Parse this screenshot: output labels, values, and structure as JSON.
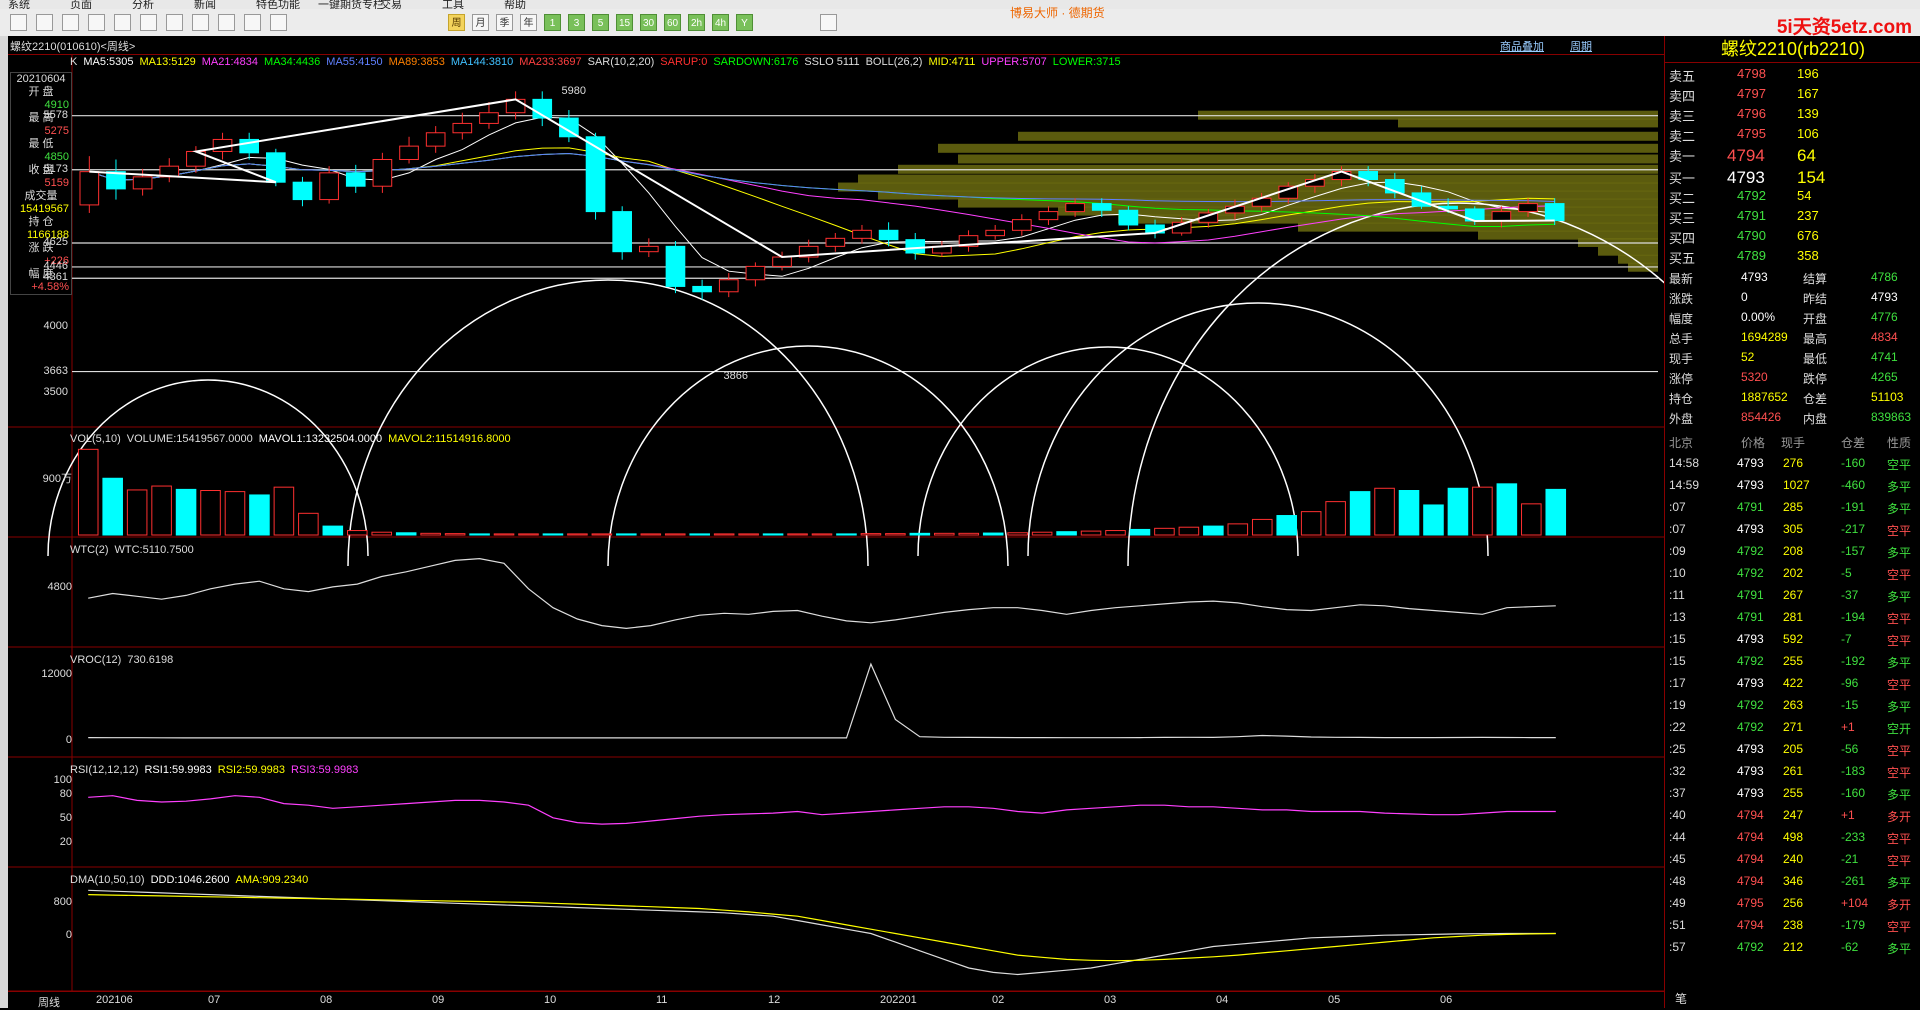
{
  "menu": [
    "系统",
    "页面",
    "分析",
    "新闻",
    "特色功能",
    "一键期货专栏",
    "交易",
    "工具",
    "帮助"
  ],
  "ad_text": "博易大师 · 德期货",
  "brand": "5i天资5etz.com",
  "toolbar_tabs": [
    "周",
    "月",
    "季",
    "年",
    "1",
    "3",
    "5",
    "15",
    "30",
    "60",
    "2h",
    "4h",
    "Y"
  ],
  "active_tab": "周",
  "chart_title": "螺纹2210(010610)<周线>",
  "links": {
    "overlay": "商品叠加",
    "period": "周期"
  },
  "ma_items": [
    {
      "text": "K",
      "color": "#dddddd"
    },
    {
      "text": "MA5:5305",
      "color": "#ffffff"
    },
    {
      "text": "MA13:5129",
      "color": "#ffff00"
    },
    {
      "text": "MA21:4834",
      "color": "#ff40ff"
    },
    {
      "text": "MA34:4436",
      "color": "#00ff00"
    },
    {
      "text": "MA55:4150",
      "color": "#6080ff"
    },
    {
      "text": "MA89:3853",
      "color": "#ff8000"
    },
    {
      "text": "MA144:3810",
      "color": "#40c0ff"
    },
    {
      "text": "MA233:3697",
      "color": "#ff4040"
    },
    {
      "text": "SAR(10,2,20)",
      "color": "#dddddd"
    },
    {
      "text": "SARUP:0",
      "color": "#ff3030"
    },
    {
      "text": "SARDOWN:6176",
      "color": "#00ff00"
    },
    {
      "text": "SSLO 5111",
      "color": "#dddddd"
    },
    {
      "text": "BOLL(26,2)",
      "color": "#dddddd"
    },
    {
      "text": "MID:4711",
      "color": "#ffff00"
    },
    {
      "text": "UPPER:5707",
      "color": "#ff40ff"
    },
    {
      "text": "LOWER:3715",
      "color": "#00ff00"
    }
  ],
  "price_axis": {
    "labels": [
      "5578",
      "5173",
      "4625",
      "4446",
      "4361",
      "4000",
      "3663",
      "3500"
    ]
  },
  "price_markers": {
    "high": "5980",
    "low": "3866"
  },
  "info_box": [
    {
      "label": "20210604",
      "value": "",
      "color": "#ffffff"
    },
    {
      "label": "开 盘",
      "value": "4910",
      "color": "#3fe03f"
    },
    {
      "label": "最 高",
      "value": "5275",
      "color": "#ff5050"
    },
    {
      "label": "最 低",
      "value": "4850",
      "color": "#3fe03f"
    },
    {
      "label": "收 盘",
      "value": "5159",
      "color": "#ff5050"
    },
    {
      "label": "成交量",
      "value": "15419567",
      "color": "#ffff00"
    },
    {
      "label": "持 仓",
      "value": "1166188",
      "color": "#ffff00"
    },
    {
      "label": "涨 跌",
      "value": "+226",
      "color": "#ff5050"
    },
    {
      "label": "幅 度",
      "value": "+4.58%",
      "color": "#ff5050"
    }
  ],
  "indicators": {
    "vol": {
      "items": [
        {
          "text": "VOL(5,10)",
          "color": "#dddddd"
        },
        {
          "text": "VOLUME:15419567.0000",
          "color": "#dddddd"
        },
        {
          "text": "MAVOL1:13232504.0000",
          "color": "#ffffff"
        },
        {
          "text": "MAVOL2:11514916.8000",
          "color": "#ffff00"
        }
      ],
      "ylabel": "900万"
    },
    "wtc": {
      "items": [
        {
          "text": "WTC(2)",
          "color": "#dddddd"
        },
        {
          "text": "WTC:5110.7500",
          "color": "#dddddd"
        }
      ],
      "ylabel": "4800"
    },
    "vroc": {
      "items": [
        {
          "text": "VROC(12)",
          "color": "#dddddd"
        },
        {
          "text": "730.6198",
          "color": "#dddddd"
        }
      ],
      "ylabels": [
        "12000",
        "0"
      ]
    },
    "rsi": {
      "items": [
        {
          "text": "RSI(12,12,12)",
          "color": "#dddddd"
        },
        {
          "text": "RSI1:59.9983",
          "color": "#ffffff"
        },
        {
          "text": "RSI2:59.9983",
          "color": "#ffff00"
        },
        {
          "text": "RSI3:59.9983",
          "color": "#ff40ff"
        }
      ],
      "ylabels": [
        "100",
        "80",
        "50",
        "20"
      ]
    },
    "dma": {
      "items": [
        {
          "text": "DMA(10,50,10)",
          "color": "#dddddd"
        },
        {
          "text": "DDD:1046.2600",
          "color": "#ffffff"
        },
        {
          "text": "AMA:909.2340",
          "color": "#ffff00"
        }
      ],
      "ylabels": [
        "800",
        "0"
      ]
    }
  },
  "x_axis": {
    "label": "周线",
    "ticks": [
      "202106",
      "07",
      "08",
      "09",
      "10",
      "11",
      "12",
      "202201",
      "02",
      "03",
      "04",
      "05",
      "06"
    ]
  },
  "quote": {
    "title": "螺纹2210(rb2210)",
    "asks": [
      {
        "label": "卖五",
        "price": "4798",
        "vol": "196"
      },
      {
        "label": "卖四",
        "price": "4797",
        "vol": "167"
      },
      {
        "label": "卖三",
        "price": "4796",
        "vol": "139"
      },
      {
        "label": "卖二",
        "price": "4795",
        "vol": "106"
      },
      {
        "label": "卖一",
        "price": "4794",
        "vol": "64"
      }
    ],
    "bids": [
      {
        "label": "买一",
        "price": "4793",
        "vol": "154"
      },
      {
        "label": "买二",
        "price": "4792",
        "vol": "54"
      },
      {
        "label": "买三",
        "price": "4791",
        "vol": "237"
      },
      {
        "label": "买四",
        "price": "4790",
        "vol": "676"
      },
      {
        "label": "买五",
        "price": "4789",
        "vol": "358"
      }
    ],
    "stats": [
      {
        "l1": "最新",
        "v1": "4793",
        "c1": "#ffffff",
        "l2": "结算",
        "v2": "4786",
        "c2": "#3fe03f"
      },
      {
        "l1": "涨跌",
        "v1": "0",
        "c1": "#ffffff",
        "l2": "昨结",
        "v2": "4793",
        "c2": "#ffffff"
      },
      {
        "l1": "幅度",
        "v1": "0.00%",
        "c1": "#ffffff",
        "l2": "开盘",
        "v2": "4776",
        "c2": "#3fe03f"
      },
      {
        "l1": "总手",
        "v1": "1694289",
        "c1": "#ffff00",
        "l2": "最高",
        "v2": "4834",
        "c2": "#ff5050"
      },
      {
        "l1": "现手",
        "v1": "52",
        "c1": "#ffff00",
        "l2": "最低",
        "v2": "4741",
        "c2": "#3fe03f"
      },
      {
        "l1": "涨停",
        "v1": "5320",
        "c1": "#ff5050",
        "l2": "跌停",
        "v2": "4265",
        "c2": "#3fe03f"
      },
      {
        "l1": "持仓",
        "v1": "1887652",
        "c1": "#ffff00",
        "l2": "仓差",
        "v2": "51103",
        "c2": "#ffff00"
      },
      {
        "l1": "外盘",
        "v1": "854426",
        "c1": "#ff5050",
        "l2": "内盘",
        "v2": "839863",
        "c2": "#3fe03f"
      }
    ],
    "tick_header": [
      "北京",
      "价格",
      "现手",
      "仓差",
      "性质"
    ],
    "ticks": [
      {
        "t": "14:58",
        "p": "4793",
        "pc": "#ffffff",
        "v": "276",
        "d": "-160",
        "dc": "#3fe03f",
        "n": "空平",
        "nc": "#3fe03f"
      },
      {
        "t": "14:59",
        "p": "4793",
        "pc": "#ffffff",
        "v": "1027",
        "d": "-460",
        "dc": "#3fe03f",
        "n": "多平",
        "nc": "#3fe03f"
      },
      {
        "t": ":07",
        "p": "4791",
        "pc": "#3fe03f",
        "v": "285",
        "d": "-191",
        "dc": "#3fe03f",
        "n": "多平",
        "nc": "#3fe03f"
      },
      {
        "t": ":07",
        "p": "4793",
        "pc": "#ffffff",
        "v": "305",
        "d": "-217",
        "dc": "#3fe03f",
        "n": "空平",
        "nc": "#ff5050"
      },
      {
        "t": ":09",
        "p": "4792",
        "pc": "#3fe03f",
        "v": "208",
        "d": "-157",
        "dc": "#3fe03f",
        "n": "多平",
        "nc": "#3fe03f"
      },
      {
        "t": ":10",
        "p": "4792",
        "pc": "#3fe03f",
        "v": "202",
        "d": "-5",
        "dc": "#3fe03f",
        "n": "空平",
        "nc": "#ff5050"
      },
      {
        "t": ":11",
        "p": "4791",
        "pc": "#3fe03f",
        "v": "267",
        "d": "-37",
        "dc": "#3fe03f",
        "n": "多平",
        "nc": "#3fe03f"
      },
      {
        "t": ":13",
        "p": "4791",
        "pc": "#3fe03f",
        "v": "281",
        "d": "-194",
        "dc": "#3fe03f",
        "n": "空平",
        "nc": "#ff5050"
      },
      {
        "t": ":15",
        "p": "4793",
        "pc": "#ffffff",
        "v": "592",
        "d": "-7",
        "dc": "#3fe03f",
        "n": "空平",
        "nc": "#ff5050"
      },
      {
        "t": ":15",
        "p": "4792",
        "pc": "#3fe03f",
        "v": "255",
        "d": "-192",
        "dc": "#3fe03f",
        "n": "多平",
        "nc": "#3fe03f"
      },
      {
        "t": ":17",
        "p": "4793",
        "pc": "#ffffff",
        "v": "422",
        "d": "-96",
        "dc": "#3fe03f",
        "n": "空平",
        "nc": "#ff5050"
      },
      {
        "t": ":19",
        "p": "4792",
        "pc": "#3fe03f",
        "v": "263",
        "d": "-15",
        "dc": "#3fe03f",
        "n": "多平",
        "nc": "#3fe03f"
      },
      {
        "t": ":22",
        "p": "4792",
        "pc": "#3fe03f",
        "v": "271",
        "d": "+1",
        "dc": "#ff5050",
        "n": "空开",
        "nc": "#3fe03f"
      },
      {
        "t": ":25",
        "p": "4793",
        "pc": "#ffffff",
        "v": "205",
        "d": "-56",
        "dc": "#3fe03f",
        "n": "空平",
        "nc": "#ff5050"
      },
      {
        "t": ":32",
        "p": "4793",
        "pc": "#ffffff",
        "v": "261",
        "d": "-183",
        "dc": "#3fe03f",
        "n": "空平",
        "nc": "#ff5050"
      },
      {
        "t": ":37",
        "p": "4793",
        "pc": "#ffffff",
        "v": "255",
        "d": "-160",
        "dc": "#3fe03f",
        "n": "多平",
        "nc": "#3fe03f"
      },
      {
        "t": ":40",
        "p": "4794",
        "pc": "#ff5050",
        "v": "247",
        "d": "+1",
        "dc": "#ff5050",
        "n": "多开",
        "nc": "#ff5050"
      },
      {
        "t": ":44",
        "p": "4794",
        "pc": "#ff5050",
        "v": "498",
        "d": "-233",
        "dc": "#3fe03f",
        "n": "空平",
        "nc": "#ff5050"
      },
      {
        "t": ":45",
        "p": "4794",
        "pc": "#ff5050",
        "v": "240",
        "d": "-21",
        "dc": "#3fe03f",
        "n": "空平",
        "nc": "#ff5050"
      },
      {
        "t": ":48",
        "p": "4794",
        "pc": "#ff5050",
        "v": "346",
        "d": "-261",
        "dc": "#3fe03f",
        "n": "多平",
        "nc": "#3fe03f"
      },
      {
        "t": ":49",
        "p": "4795",
        "pc": "#ff5050",
        "v": "256",
        "d": "+104",
        "dc": "#ff5050",
        "n": "多开",
        "nc": "#ff5050"
      },
      {
        "t": ":51",
        "p": "4794",
        "pc": "#ff5050",
        "v": "238",
        "d": "-179",
        "dc": "#3fe03f",
        "n": "空平",
        "nc": "#ff5050"
      },
      {
        "t": ":57",
        "p": "4792",
        "pc": "#3fe03f",
        "v": "212",
        "d": "-62",
        "dc": "#3fe03f",
        "n": "多平",
        "nc": "#3fe03f"
      }
    ],
    "footer_tab": "笔"
  },
  "chart_data": {
    "type": "candlestick",
    "title": "螺纹2210(010610)<周线>",
    "x_ticks": [
      "202106",
      "07",
      "08",
      "09",
      "10",
      "11",
      "12",
      "202201",
      "02",
      "03",
      "04",
      "05",
      "06"
    ],
    "candles": [
      [
        4910,
        5159,
        4850,
        5275
      ],
      [
        5159,
        5030,
        4950,
        5250
      ],
      [
        5030,
        5120,
        4980,
        5180
      ],
      [
        5120,
        5200,
        5080,
        5260
      ],
      [
        5200,
        5310,
        5150,
        5350
      ],
      [
        5310,
        5400,
        5250,
        5450
      ],
      [
        5400,
        5300,
        5250,
        5450
      ],
      [
        5300,
        5080,
        5050,
        5330
      ],
      [
        5080,
        4950,
        4900,
        5120
      ],
      [
        4950,
        5150,
        4920,
        5200
      ],
      [
        5150,
        5050,
        5000,
        5210
      ],
      [
        5050,
        5250,
        5000,
        5300
      ],
      [
        5250,
        5350,
        5220,
        5420
      ],
      [
        5350,
        5450,
        5300,
        5500
      ],
      [
        5450,
        5520,
        5400,
        5600
      ],
      [
        5520,
        5600,
        5480,
        5680
      ],
      [
        5600,
        5700,
        5550,
        5760
      ],
      [
        5700,
        5560,
        5500,
        5760
      ],
      [
        5560,
        5420,
        5380,
        5620
      ],
      [
        5420,
        4860,
        4800,
        5450
      ],
      [
        4860,
        4560,
        4500,
        4900
      ],
      [
        4560,
        4600,
        4520,
        4660
      ],
      [
        4600,
        4300,
        4250,
        4640
      ],
      [
        4300,
        4260,
        4200,
        4350
      ],
      [
        4260,
        4350,
        4220,
        4400
      ],
      [
        4350,
        4450,
        4300,
        4480
      ],
      [
        4450,
        4520,
        4420,
        4560
      ],
      [
        4520,
        4600,
        4480,
        4650
      ],
      [
        4600,
        4660,
        4560,
        4700
      ],
      [
        4660,
        4720,
        4620,
        4760
      ],
      [
        4720,
        4650,
        4600,
        4780
      ],
      [
        4650,
        4550,
        4500,
        4700
      ],
      [
        4550,
        4600,
        4520,
        4640
      ],
      [
        4600,
        4680,
        4560,
        4720
      ],
      [
        4680,
        4720,
        4650,
        4760
      ],
      [
        4720,
        4800,
        4680,
        4840
      ],
      [
        4800,
        4860,
        4760,
        4900
      ],
      [
        4860,
        4920,
        4820,
        4960
      ],
      [
        4920,
        4870,
        4820,
        4960
      ],
      [
        4870,
        4760,
        4720,
        4900
      ],
      [
        4760,
        4700,
        4660,
        4800
      ],
      [
        4700,
        4780,
        4680,
        4820
      ],
      [
        4780,
        4850,
        4740,
        4880
      ],
      [
        4850,
        4900,
        4800,
        4950
      ],
      [
        4900,
        4960,
        4860,
        5000
      ],
      [
        4960,
        5050,
        4920,
        5080
      ],
      [
        5050,
        5100,
        5000,
        5140
      ],
      [
        5100,
        5160,
        5050,
        5200
      ],
      [
        5160,
        5100,
        5050,
        5200
      ],
      [
        5100,
        5000,
        4960,
        5150
      ],
      [
        5000,
        4900,
        4880,
        5050
      ],
      [
        4900,
        4880,
        4850,
        4960
      ],
      [
        4880,
        4790,
        4760,
        4900
      ],
      [
        4790,
        4860,
        4740,
        4900
      ],
      [
        4860,
        4920,
        4820,
        4960
      ],
      [
        4920,
        4793,
        4760,
        4960
      ]
    ],
    "volumes": [
      15.4,
      10.2,
      8.1,
      8.8,
      8.2,
      8.0,
      7.8,
      7.2,
      8.6,
      3.9,
      1.6,
      0.8,
      0.5,
      0.4,
      0.3,
      0.25,
      0.2,
      0.2,
      0.2,
      0.2,
      0.2,
      0.2,
      0.2,
      0.2,
      0.2,
      0.2,
      0.2,
      0.2,
      0.2,
      0.2,
      0.2,
      0.2,
      0.25,
      0.25,
      0.3,
      0.3,
      0.3,
      0.35,
      0.4,
      0.5,
      0.6,
      0.7,
      0.8,
      1.0,
      1.2,
      1.4,
      1.6,
      2.0,
      2.8,
      3.5,
      4.2,
      6.0,
      7.8,
      8.4,
      8.0,
      5.4,
      8.4,
      8.6,
      9.2,
      5.6,
      8.2
    ],
    "wtc": [
      5050,
      5100,
      5070,
      5040,
      5080,
      5150,
      5200,
      5230,
      5150,
      5120,
      5170,
      5200,
      5280,
      5330,
      5390,
      5450,
      5470,
      5420,
      5150,
      4950,
      4830,
      4760,
      4730,
      4760,
      4820,
      4870,
      4890,
      4880,
      4910,
      4920,
      4860,
      4810,
      4790,
      4820,
      4860,
      4900,
      4930,
      4950,
      4950,
      4920,
      4880,
      4920,
      4950,
      4970,
      4990,
      5010,
      5020,
      5000,
      4960,
      4930,
      4920,
      4950,
      4980,
      4970,
      4940,
      4920,
      4900,
      4880,
      4950,
      4960,
      4970
    ],
    "vroc": [
      60,
      40,
      30,
      20,
      10,
      10,
      10,
      5,
      5,
      5,
      5,
      0,
      0,
      0,
      0,
      0,
      0,
      0,
      0,
      0,
      0,
      0,
      0,
      0,
      0,
      0,
      0,
      0,
      0,
      0,
      0,
      0,
      12000,
      3000,
      200,
      100,
      80,
      70,
      60,
      50,
      40,
      40,
      40,
      60,
      80,
      100,
      80,
      200,
      400,
      300,
      150,
      100,
      80,
      60,
      50,
      60,
      70,
      80,
      70,
      60,
      60
    ],
    "rsi": [
      68,
      70,
      64,
      62,
      63,
      66,
      70,
      68,
      60,
      58,
      54,
      56,
      58,
      60,
      62,
      64,
      64,
      62,
      58,
      42,
      36,
      34,
      35,
      38,
      41,
      44,
      46,
      47,
      48,
      50,
      46,
      48,
      50,
      52,
      54,
      56,
      56,
      54,
      50,
      48,
      52,
      54,
      56,
      58,
      58,
      56,
      56,
      54,
      52,
      52,
      50,
      50,
      50,
      48,
      47,
      46,
      46,
      48,
      50,
      50,
      50
    ],
    "dma": [
      1000,
      980,
      960,
      940,
      920,
      900,
      880,
      860,
      840,
      820,
      800,
      780,
      760,
      740,
      720,
      700,
      680,
      660,
      640,
      620,
      600,
      580,
      560,
      540,
      520,
      500,
      480,
      440,
      400,
      300,
      200,
      100,
      0,
      -200,
      -400,
      -600,
      -800,
      -900,
      -950,
      -900,
      -850,
      -800,
      -700,
      -600,
      -500,
      -400,
      -300,
      -250,
      -200,
      -150,
      -100,
      -80,
      -60,
      -40,
      -30,
      -20,
      -10,
      -5,
      0,
      0,
      0
    ],
    "ama": [
      900,
      890,
      880,
      870,
      860,
      850,
      840,
      830,
      820,
      810,
      800,
      790,
      780,
      770,
      760,
      750,
      740,
      730,
      720,
      700,
      680,
      660,
      640,
      620,
      600,
      580,
      540,
      500,
      450,
      400,
      300,
      200,
      100,
      0,
      -100,
      -200,
      -300,
      -400,
      -500,
      -550,
      -600,
      -620,
      -630,
      -620,
      -600,
      -570,
      -540,
      -500,
      -450,
      -400,
      -350,
      -300,
      -250,
      -200,
      -150,
      -100,
      -70,
      -40,
      -20,
      -10,
      0
    ]
  }
}
